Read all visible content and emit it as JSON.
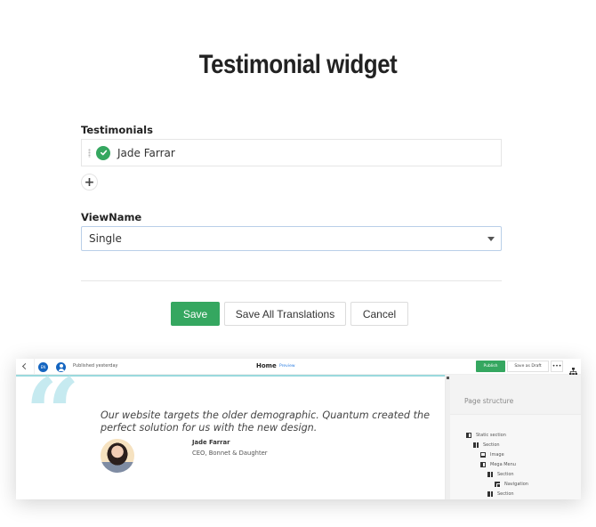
{
  "header": {
    "title": "Testimonial widget"
  },
  "form": {
    "testimonials": {
      "label": "Testimonials",
      "items": [
        {
          "name": "Jade Farrar",
          "status": "published",
          "status_icon": "check-circle-icon"
        }
      ],
      "add_icon": "plus-icon"
    },
    "viewname": {
      "label": "ViewName",
      "selected": "Single"
    },
    "buttons": {
      "save": "Save",
      "save_all": "Save All Translations",
      "cancel": "Cancel"
    }
  },
  "preview": {
    "topbar": {
      "back_icon": "chevron-left-icon",
      "language": "EN",
      "status": "Published yesterday",
      "page_name": "Home",
      "preview_link": "Preview",
      "publish": "Publish",
      "save_draft": "Save as Draft",
      "more": "•••",
      "tree_icon": "sitemap-icon"
    },
    "testimonial": {
      "quote_mark": "“",
      "quote": "Our website targets the older demographic. Quantum created the perfect solution for us with the new design.",
      "author": "Jade Farrar",
      "role": "CEO, Bonnet & Daughter"
    },
    "side_panel": {
      "title": "Page structure",
      "tree": [
        {
          "label": "Static section",
          "type": "static",
          "depth": 0
        },
        {
          "label": "Section",
          "type": "section",
          "depth": 1
        },
        {
          "label": "Image",
          "type": "image",
          "depth": 2
        },
        {
          "label": "Mega Menu",
          "type": "static",
          "depth": 2
        },
        {
          "label": "Section",
          "type": "section",
          "depth": 3
        },
        {
          "label": "Navigation",
          "type": "nav",
          "depth": 4
        },
        {
          "label": "Section",
          "type": "section",
          "depth": 3
        }
      ]
    }
  },
  "colors": {
    "primary_green": "#35a760",
    "accent_teal": "#9ad9dd",
    "quote_mark": "#c6eaf0",
    "badge_blue": "#1565c0",
    "link_blue": "#2a7de1"
  }
}
